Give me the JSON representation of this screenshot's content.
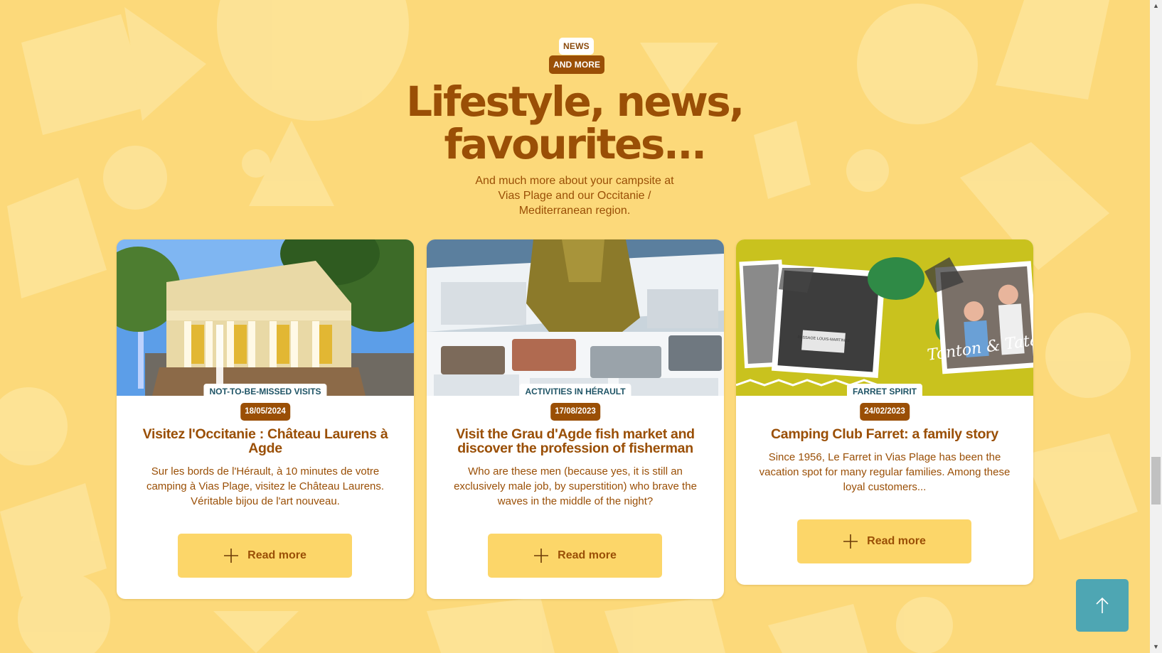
{
  "section": {
    "kicker_top": "NEWS",
    "kicker_bottom": "AND MORE",
    "title_line1": "Lifestyle, news,",
    "title_line2": "favourites...",
    "subtitle": "And much more about your campsite at Vias Plage and our Occitanie / Mediterranean region."
  },
  "cards": [
    {
      "category": "NOT-TO-BE-MISSED VISITS",
      "date": "18/05/2024",
      "title": "Visitez l'Occitanie : Château Laurens à Agde",
      "excerpt": "Sur les bords de l'Hérault, à 10 minutes de votre camping à Vias Plage, visitez le Château Laurens. Véritable bijou de l'art nouveau.",
      "button_label": "Read more",
      "image": "chateau-laurens-photo"
    },
    {
      "category": "ACTIVITIES IN HÉRAULT",
      "date": "17/08/2023",
      "title": "Visit the Grau d'Agde fish market and discover the profession of fisherman",
      "excerpt": "Who are these men (because yes, it is still an exclusively male job, by superstition) who brave the waves in the middle of the night?",
      "button_label": "Read more",
      "image": "fish-market-photo"
    },
    {
      "category": "FARRET SPIRIT",
      "date": "24/02/2023",
      "title": "Camping Club Farret: a family story",
      "excerpt": "Since 1956, Le Farret in Vias Plage has been the vacation spot for many regular families. Among these loyal customers...",
      "button_label": "Read more",
      "image": "family-collage-photo",
      "image_caption": "Tonton & Tata",
      "photo_sign": "PASSAGE LOUIS-MARTINEZ"
    }
  ],
  "back_to_top_icon": "arrow-up-icon",
  "colors": {
    "background": "#fcd97a",
    "brand_brown": "#9a4f06",
    "button_yellow": "#fcd669",
    "teal": "#4ea6b3",
    "category_text": "#1f5466"
  }
}
